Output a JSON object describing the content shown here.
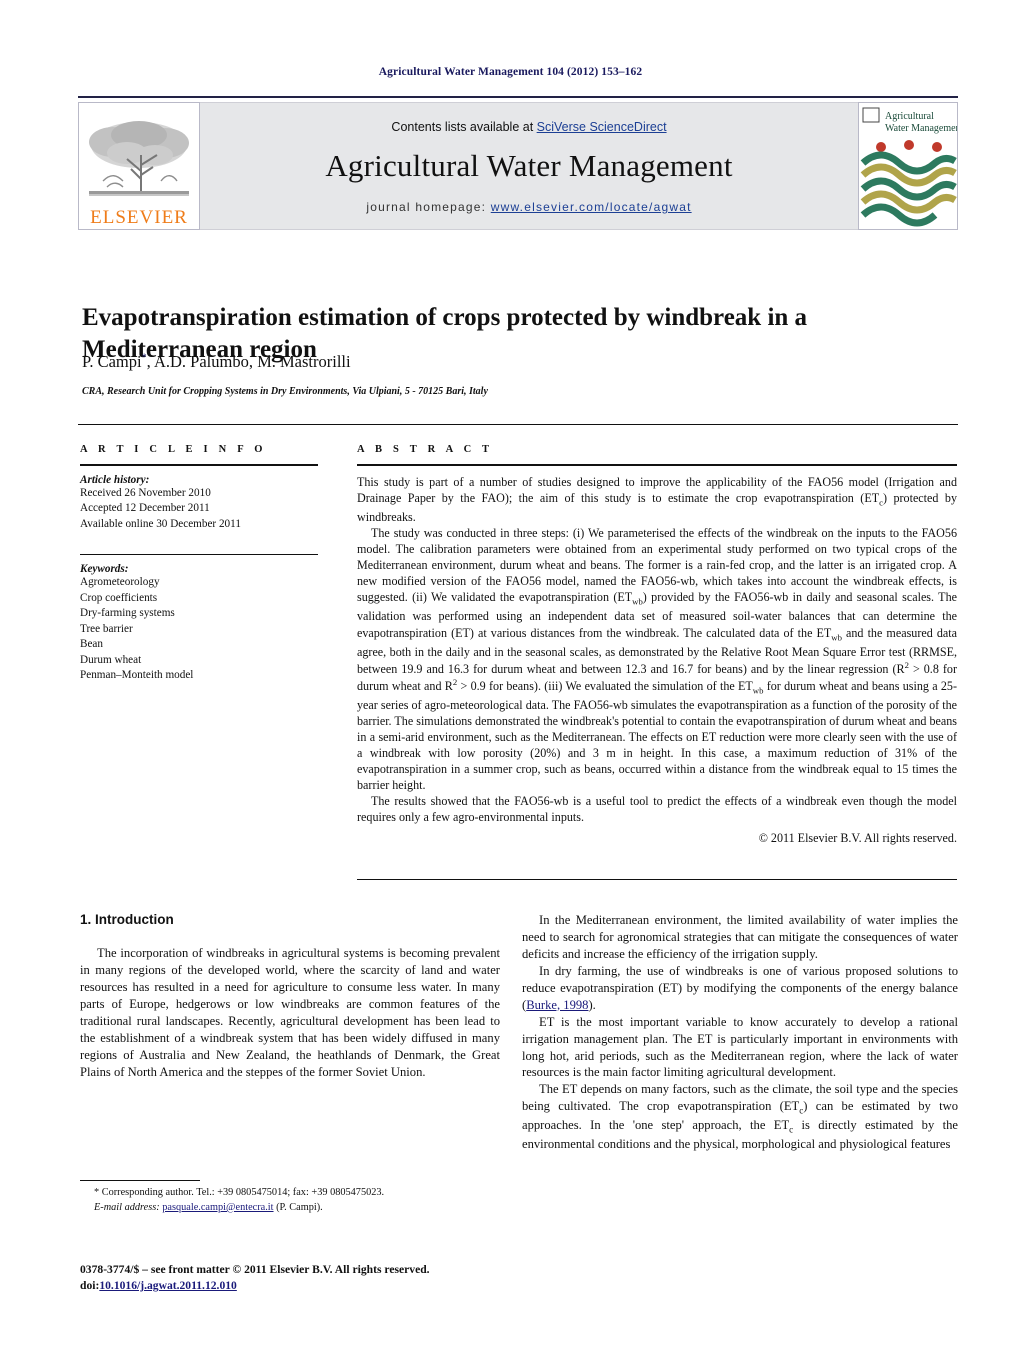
{
  "running_head": "Agricultural Water Management 104 (2012) 153–162",
  "masthead": {
    "contents_prefix": "Contents lists available at ",
    "contents_link": "SciVerse ScienceDirect",
    "journal_name": "Agricultural Water Management",
    "homepage_label": "journal homepage:",
    "homepage_url": "www.elsevier.com/locate/agwat",
    "publisher_logo_text": "ELSEVIER",
    "cover_title_line1": "Agricultural",
    "cover_title_line2": "Water Management",
    "accent_link_color": "#1c3f94",
    "logo_orange": "#ef7c19",
    "masthead_bg": "#e6e7e9"
  },
  "article": {
    "title": "Evapotranspiration estimation of crops protected by windbreak in a Mediterranean region",
    "authors": "P. Campi, A.D. Palumbo, M. Mastrorilli",
    "corresponding_marker": "*",
    "affiliation": "CRA, Research Unit for Cropping Systems in Dry Environments, Via Ulpiani, 5 - 70125 Bari, Italy"
  },
  "info": {
    "heading": "A R T I C L E   I N F O",
    "history_label": "Article history:",
    "history": [
      "Received 26 November 2010",
      "Accepted 12 December 2011",
      "Available online 30 December 2011"
    ],
    "keywords_label": "Keywords:",
    "keywords": [
      "Agrometeorology",
      "Crop coefficients",
      "Dry-farming systems",
      "Tree barrier",
      "Bean",
      "Durum wheat",
      "Penman–Monteith model"
    ]
  },
  "abstract": {
    "heading": "A B S T R A C T",
    "paragraph1_a": "This study is part of a number of studies designed to improve the applicability of the FAO56 model (Irrigation and Drainage Paper by the FAO); the aim of this study is to estimate the crop evapotranspiration (ET",
    "paragraph1_sub": "c",
    "paragraph1_b": ") protected by windbreaks.",
    "paragraph2_a": "The study was conducted in three steps: (i) We parameterised the effects of the windbreak on the inputs to the FAO56 model. The calibration parameters were obtained from an experimental study performed on two typical crops of the Mediterranean environment, durum wheat and beans. The former is a rain-fed crop, and the latter is an irrigated crop. A new modified version of the FAO56 model, named the FAO56-wb, which takes into account the windbreak effects, is suggested. (ii) We validated the evapotranspiration (ET",
    "paragraph2_sub1": "wb",
    "paragraph2_b": ") provided by the FAO56-wb in daily and seasonal scales. The validation was performed using an independent data set of measured soil-water balances that can determine the evapotranspiration (ET) at various distances from the windbreak. The calculated data of the ET",
    "paragraph2_sub2": "wb",
    "paragraph2_c": " and the measured data agree, both in the daily and in the seasonal scales, as demonstrated by the Relative Root Mean Square Error test (RRMSE, between 19.9 and 16.3 for durum wheat and between 12.3 and 16.7 for beans) and by the linear regression (R",
    "paragraph2_sup1": "2",
    "paragraph2_d": " > 0.8 for durum wheat and R",
    "paragraph2_sup2": "2",
    "paragraph2_e": " > 0.9 for beans). (iii) We evaluated the simulation of the ET",
    "paragraph2_sub3": "wb",
    "paragraph2_f": " for durum wheat and beans using a 25-year series of agro-meteorological data. The FAO56-wb simulates the evapotranspiration as a function of the porosity of the barrier. The simulations demonstrated the windbreak's potential to contain the evapotranspiration of durum wheat and beans in a semi-arid environment, such as the Mediterranean. The effects on ET reduction were more clearly seen with the use of a windbreak with low porosity (20%) and 3 m in height. In this case, a maximum reduction of 31% of the evapotranspiration in a summer crop, such as beans, occurred within a distance from the windbreak equal to 15 times the barrier height.",
    "paragraph3": "The results showed that the FAO56-wb is a useful tool to predict the effects of a windbreak even though the model requires only a few agro-environmental inputs.",
    "copyright": "© 2011 Elsevier B.V. All rights reserved."
  },
  "intro": {
    "heading": "1.  Introduction",
    "left_p1": "The incorporation of windbreaks in agricultural systems is becoming prevalent in many regions of the developed world, where the scarcity of land and water resources has resulted in a need for agriculture to consume less water. In many parts of Europe, hedgerows or low windbreaks are common features of the traditional rural landscapes. Recently, agricultural development has been lead to the establishment of a windbreak system that has been widely diffused in many regions of Australia and New Zealand, the heathlands of Denmark, the Great Plains of North America and the steppes of the former Soviet Union.",
    "right_p1": "In the Mediterranean environment, the limited availability of water implies the need to search for agronomical strategies that can mitigate the consequences of water deficits and increase the efficiency of the irrigation supply.",
    "right_p2_a": "In dry farming, the use of windbreaks is one of various proposed solutions to reduce evapotranspiration (ET) by modifying the components of the energy balance (",
    "right_p2_link": "Burke, 1998",
    "right_p2_b": ").",
    "right_p3": "ET is the most important variable to know accurately to develop a rational irrigation management plan. The ET is particularly important in environments with long hot, arid periods, such as the Mediterranean region, where the lack of water resources is the main factor limiting agricultural development.",
    "right_p4_a": "The ET depends on many factors, such as the climate, the soil type and the species being cultivated. The crop evapotranspiration (ET",
    "right_p4_sub1": "c",
    "right_p4_b": ") can be estimated by two approaches. In the 'one step' approach, the ET",
    "right_p4_sub2": "c",
    "right_p4_c": " is directly estimated by the environmental conditions and the physical, morphological and physiological features"
  },
  "footnote": {
    "corresponding": "* Corresponding author. Tel.: +39 0805475014; fax: +39 0805475023.",
    "email_label": "E-mail address:",
    "email": "pasquale.campi@entecra.it",
    "email_suffix": "(P. Campi)."
  },
  "footer": {
    "issn_line": "0378-3774/$ – see front matter © 2011 Elsevier B.V. All rights reserved.",
    "doi_label": "doi:",
    "doi": "10.1016/j.agwat.2011.12.010"
  }
}
